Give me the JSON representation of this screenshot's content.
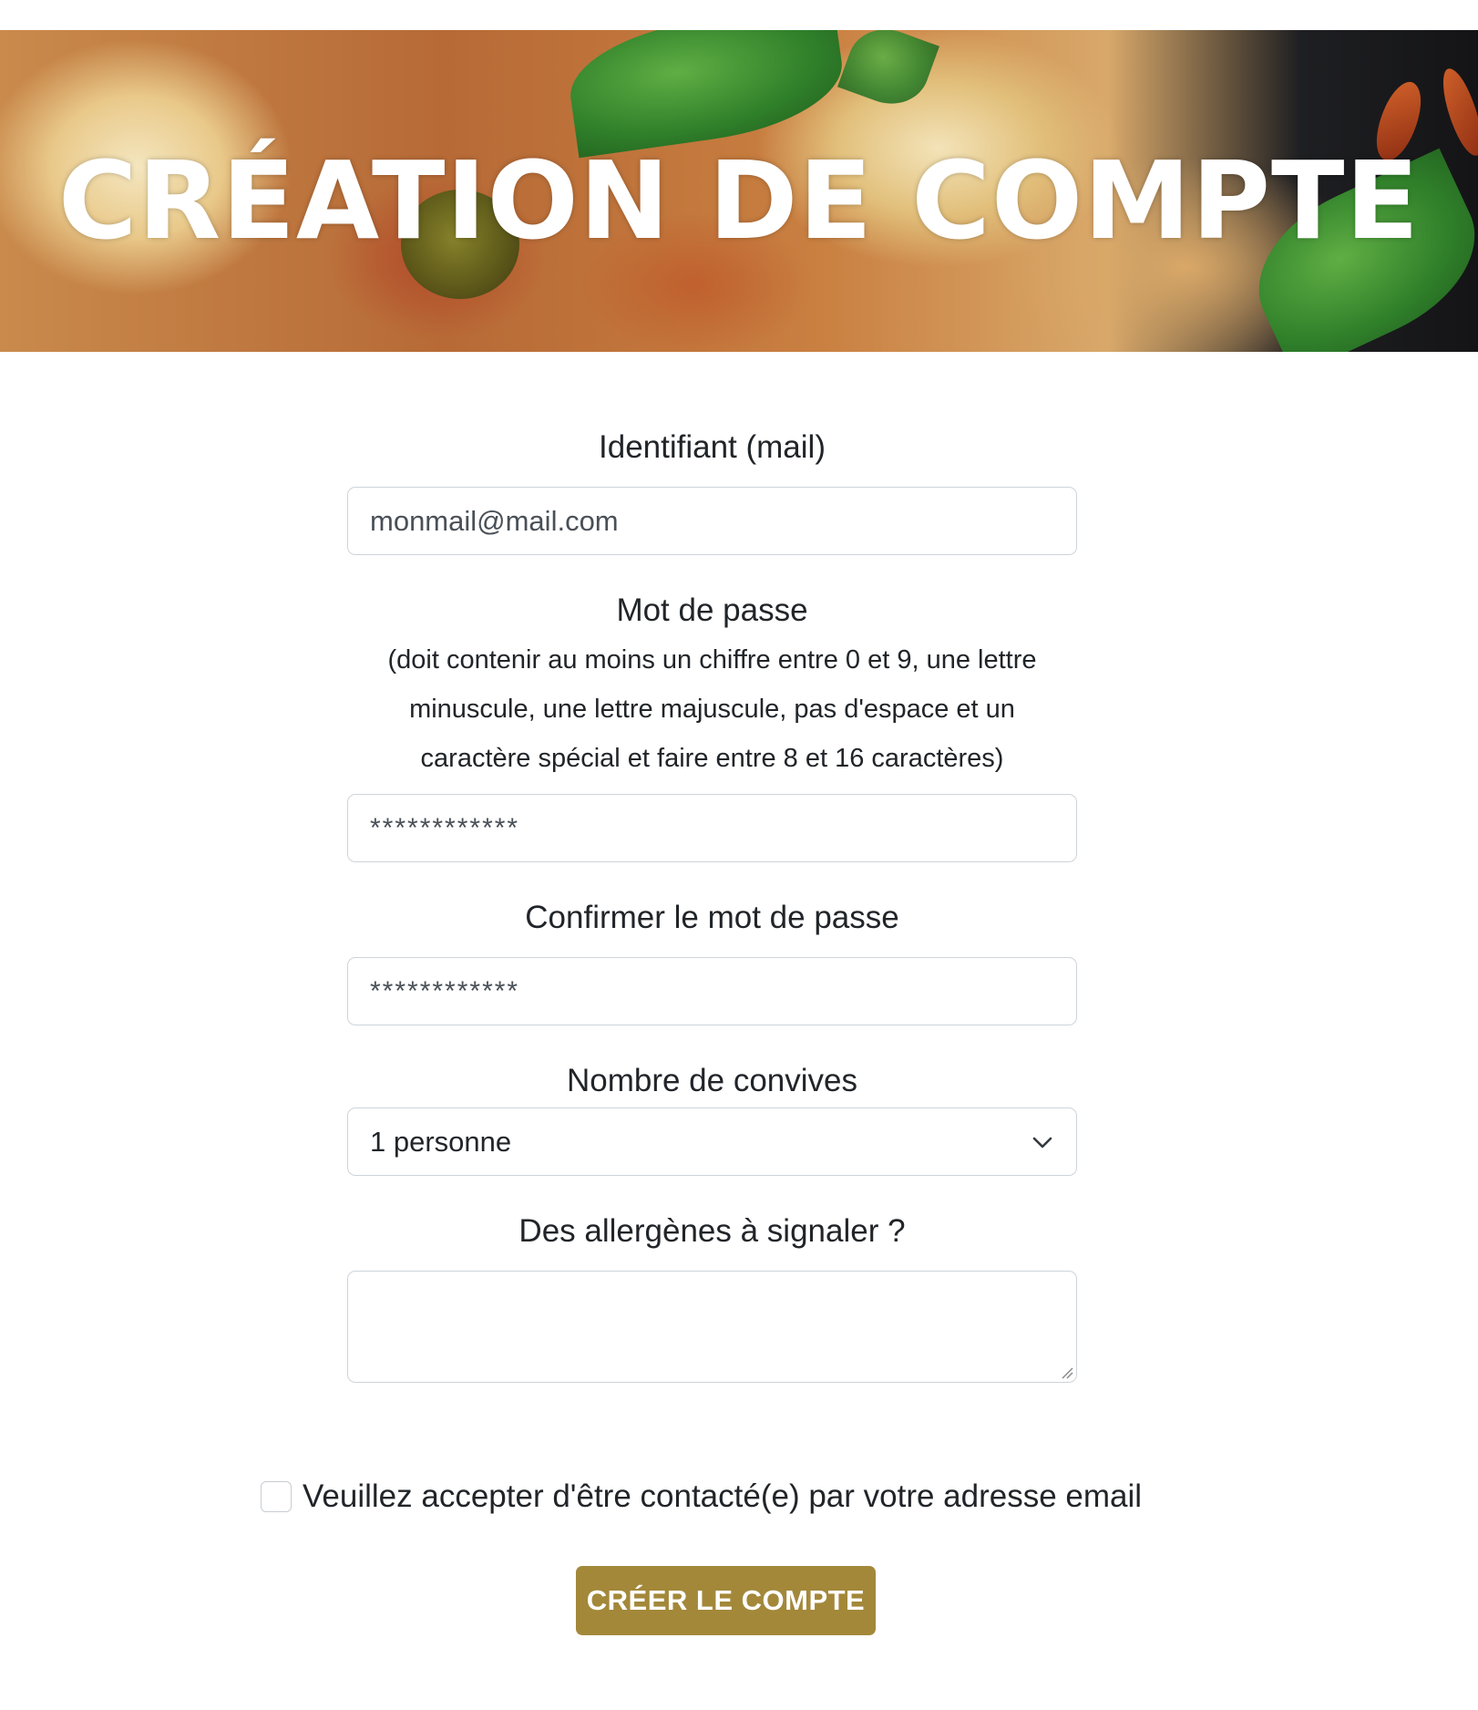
{
  "hero": {
    "title": "CRÉATION DE COMPTE"
  },
  "form": {
    "email": {
      "label": "Identifiant (mail)",
      "placeholder": "monmail@mail.com"
    },
    "password": {
      "label": "Mot de passe",
      "hint_lines": [
        "(doit contenir au moins un chiffre entre 0 et 9, une lettre",
        "minuscule, une lettre majuscule, pas d'espace et un",
        "caractère spécial et faire entre 8 et 16 caractères)"
      ],
      "value": "************"
    },
    "confirm_password": {
      "label": "Confirmer le mot de passe",
      "value": "************"
    },
    "guests": {
      "label": "Nombre de convives",
      "selected": "1 personne"
    },
    "allergens": {
      "label": "Des allergènes à signaler ?",
      "value": ""
    },
    "consent": {
      "label": "Veuillez accepter d'être contacté(e) par votre adresse email",
      "checked": false
    },
    "submit_label": "CRÉER LE COMPTE"
  },
  "colors": {
    "button_background": "#a3883a",
    "input_border": "#ced4da",
    "text": "#212529"
  }
}
